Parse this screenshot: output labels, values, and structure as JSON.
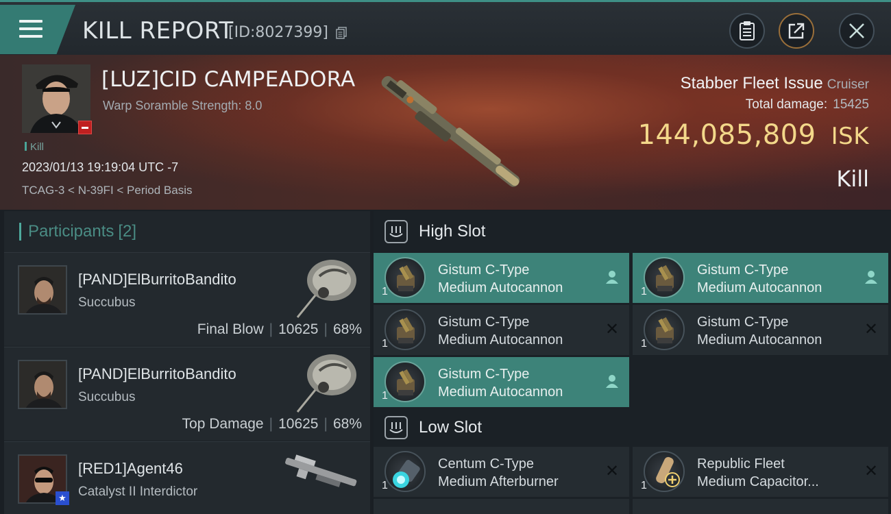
{
  "header": {
    "title": "KILL REPORT",
    "report_id": "[ID:8027399]"
  },
  "victim": {
    "name": "[LUZ]CID CAMPEADORA",
    "subtitle": "Warp Soramble Strength: 8.0",
    "tag": "Kill",
    "timestamp": "2023/01/13 19:19:04 UTC -7",
    "location": "TCAG-3 < N-39FI < Period Basis",
    "ship_name": "Stabber Fleet Issue",
    "ship_class": "Cruiser",
    "total_damage_label": "Total damage:",
    "total_damage": "15425",
    "isk_value": "144,085,809",
    "isk_unit": "ISK",
    "result": "Kill"
  },
  "participants": {
    "label": "Participants",
    "count": "[2]",
    "rows": [
      {
        "name": "[PAND]ElBurritoBandito",
        "ship": "Succubus",
        "role": "Final Blow",
        "damage": "10625",
        "percent": "68%"
      },
      {
        "name": "[PAND]ElBurritoBandito",
        "ship": "Succubus",
        "role": "Top Damage",
        "damage": "10625",
        "percent": "68%"
      },
      {
        "name": "[RED1]Agent46",
        "ship": "Catalyst II Interdictor"
      }
    ]
  },
  "slots": {
    "high": {
      "label": "High Slot",
      "modules": [
        {
          "qty": "1",
          "line1": "Gistum C-Type",
          "line2": "Medium Autocannon",
          "state": "user-icon"
        },
        {
          "qty": "1",
          "line1": "Gistum C-Type",
          "line2": "Medium Autocannon",
          "state": "user-icon"
        },
        {
          "qty": "1",
          "line1": "Gistum C-Type",
          "line2": "Medium Autocannon",
          "state": "destroyed-icon"
        },
        {
          "qty": "1",
          "line1": "Gistum C-Type",
          "line2": "Medium Autocannon",
          "state": "destroyed-icon"
        },
        {
          "qty": "1",
          "line1": "Gistum C-Type",
          "line2": "Medium Autocannon",
          "state": "user-icon"
        }
      ]
    },
    "low": {
      "label": "Low Slot",
      "modules": [
        {
          "qty": "1",
          "line1": "Centum C-Type",
          "line2": "Medium Afterburner",
          "state": "destroyed-icon"
        },
        {
          "qty": "1",
          "line1": "Republic Fleet",
          "line2": "Medium Capacitor...",
          "state": "destroyed-icon"
        }
      ]
    }
  },
  "colors": {
    "accent": "#3d8379",
    "isk": "#f3d88a",
    "badge_red": "#c02020"
  }
}
